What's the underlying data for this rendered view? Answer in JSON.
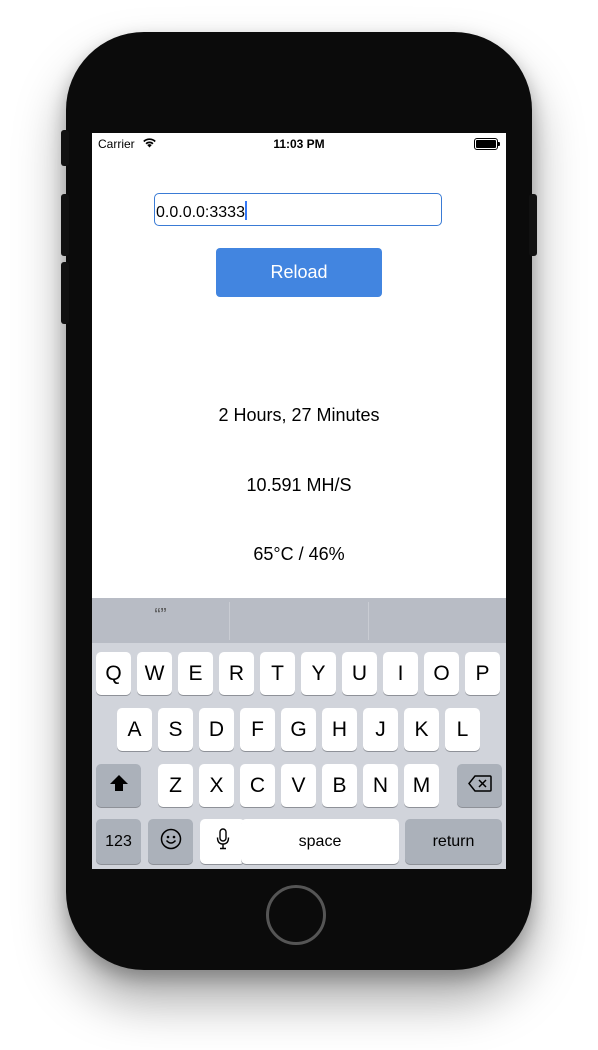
{
  "status_bar": {
    "carrier": "Carrier",
    "time": "11:03 PM"
  },
  "address_field": {
    "value": "0.0.0.0:3333"
  },
  "reload_label": "Reload",
  "stats": {
    "uptime": "2 Hours, 27 Minutes",
    "hashrate": "10.591 MH/S",
    "temperature_fan": "65°C / 46%"
  },
  "keyboard": {
    "suggestion": "“”",
    "row1": [
      "Q",
      "W",
      "E",
      "R",
      "T",
      "Y",
      "U",
      "I",
      "O",
      "P"
    ],
    "row2": [
      "A",
      "S",
      "D",
      "F",
      "G",
      "H",
      "J",
      "K",
      "L"
    ],
    "row3": [
      "Z",
      "X",
      "C",
      "V",
      "B",
      "N",
      "M"
    ],
    "numbers_label": "123",
    "space_label": "space",
    "return_label": "return",
    "icons": [
      "shift-icon",
      "backspace-icon",
      "emoji-icon",
      "microphone-icon"
    ]
  }
}
